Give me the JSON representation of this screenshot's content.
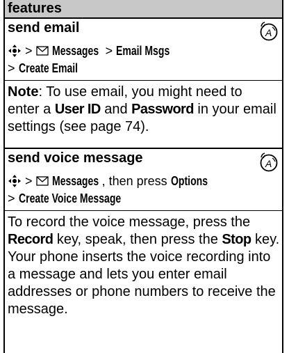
{
  "table": {
    "header": "features"
  },
  "features": [
    {
      "title": "send email",
      "path": {
        "sep": ">",
        "messages": "Messages",
        "email_msgs": "Email Msgs",
        "create_email": "Create Email"
      },
      "note": {
        "label": "Note",
        "t1": ": To use email, you might need to",
        "t2": "enter a",
        "user_id": "User ID",
        "t3": "and",
        "password": "Password",
        "t4": "in your email",
        "t5": "settings (see page 74)."
      }
    },
    {
      "title": "send voice message",
      "path": {
        "sep": ">",
        "messages": "Messages",
        "then_press": ", then press",
        "options": "Options",
        "create_voice": "Create Voice Message"
      },
      "body": {
        "t1": "To record the voice message, press the",
        "record": "Record",
        "t2": "key, speak, then press the",
        "stop": "Stop",
        "t3": "key.",
        "t4": "Your phone inserts the voice recording into",
        "t5": "a message and lets you enter email",
        "t6": "addresses or phone numbers to receive the",
        "t7": "message."
      }
    }
  ],
  "icons": [
    "nav-key-icon",
    "envelope-icon",
    "network-feature-icon"
  ],
  "colors": {
    "header_bg": "#c8c8c8",
    "text": "#000000"
  }
}
